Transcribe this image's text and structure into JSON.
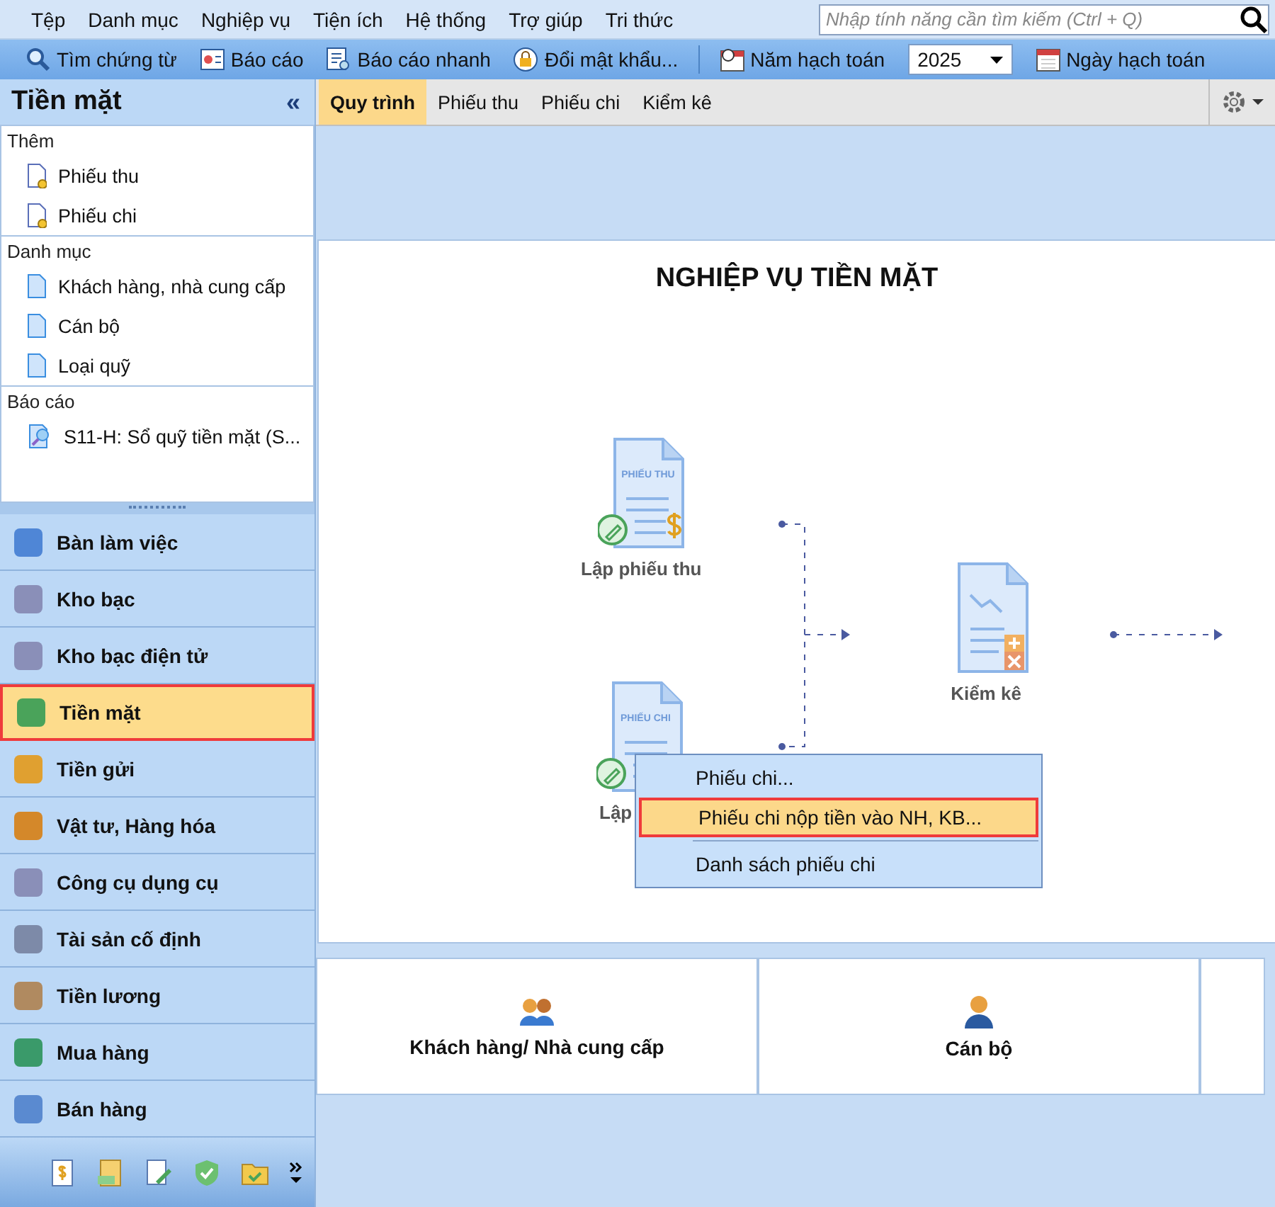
{
  "menu": [
    {
      "label": "Tệp"
    },
    {
      "label": "Danh mục"
    },
    {
      "label": "Nghiệp vụ"
    },
    {
      "label": "Tiện ích"
    },
    {
      "label": "Hệ thống"
    },
    {
      "label": "Trợ giúp"
    },
    {
      "label": "Tri thức"
    }
  ],
  "search": {
    "placeholder": "Nhập tính năng cần tìm kiếm (Ctrl + Q)"
  },
  "toolbar": [
    {
      "label": "Tìm chứng từ",
      "kind": "search"
    },
    {
      "label": "Báo cáo",
      "kind": "report"
    },
    {
      "label": "Báo cáo nhanh",
      "kind": "quick"
    },
    {
      "label": "Đổi mật khẩu...",
      "kind": "lock"
    },
    {
      "label": "Năm hạch toán",
      "kind": "year"
    },
    {
      "label": "Ngày hạch toán",
      "kind": "calendar"
    }
  ],
  "year_select": {
    "value": "2025"
  },
  "panel": {
    "title": "Tiền mặt",
    "collapse": "«"
  },
  "sections": [
    {
      "title": "Thêm",
      "items": [
        {
          "label": "Phiếu thu",
          "kind": "new"
        },
        {
          "label": "Phiếu chi",
          "kind": "new"
        }
      ]
    },
    {
      "title": "Danh mục",
      "items": [
        {
          "label": "Khách hàng, nhà cung cấp",
          "kind": "list"
        },
        {
          "label": "Cán bộ",
          "kind": "list"
        },
        {
          "label": "Loại quỹ",
          "kind": "list"
        }
      ]
    },
    {
      "title": "Báo cáo",
      "items": [
        {
          "label": "S11-H: Sổ quỹ tiền mặt (S...",
          "kind": "report"
        }
      ]
    }
  ],
  "nav": [
    {
      "label": "Bàn làm việc",
      "selected": false
    },
    {
      "label": "Kho bạc",
      "selected": false
    },
    {
      "label": "Kho bạc điện tử",
      "selected": false
    },
    {
      "label": "Tiền mặt",
      "selected": true
    },
    {
      "label": "Tiền gửi",
      "selected": false
    },
    {
      "label": "Vật tư, Hàng hóa",
      "selected": false
    },
    {
      "label": "Công cụ dụng cụ",
      "selected": false
    },
    {
      "label": "Tài sản cố định",
      "selected": false
    },
    {
      "label": "Tiền lương",
      "selected": false
    },
    {
      "label": "Mua hàng",
      "selected": false
    },
    {
      "label": "Bán hàng",
      "selected": false
    }
  ],
  "tabs": [
    {
      "label": "Quy trình",
      "selected": true
    },
    {
      "label": "Phiếu thu",
      "selected": false
    },
    {
      "label": "Phiếu chi",
      "selected": false
    },
    {
      "label": "Kiểm kê",
      "selected": false
    }
  ],
  "diagram": {
    "title": "NGHIỆP VỤ TIỀN MẶT",
    "nodes": [
      {
        "kind": "receipt",
        "doc_text": "PHIẾU THU",
        "label": "Lập phiếu thu"
      },
      {
        "kind": "payment",
        "doc_text": "PHIẾU CHI",
        "label": "Lập"
      },
      {
        "kind": "count",
        "label": "Kiểm kê"
      }
    ]
  },
  "context_menu": [
    {
      "label": "Phiếu chi...",
      "selected": false
    },
    {
      "label": "Phiếu chi nộp tiền vào NH, KB...",
      "selected": true
    },
    {
      "label": "Danh sách phiếu chi",
      "selected": false
    }
  ],
  "bottom_cards": [
    {
      "label": "Khách hàng/ Nhà cung cấp",
      "kind": "customers"
    },
    {
      "label": "Cán bộ",
      "kind": "staff"
    },
    {
      "kind": "more"
    }
  ]
}
